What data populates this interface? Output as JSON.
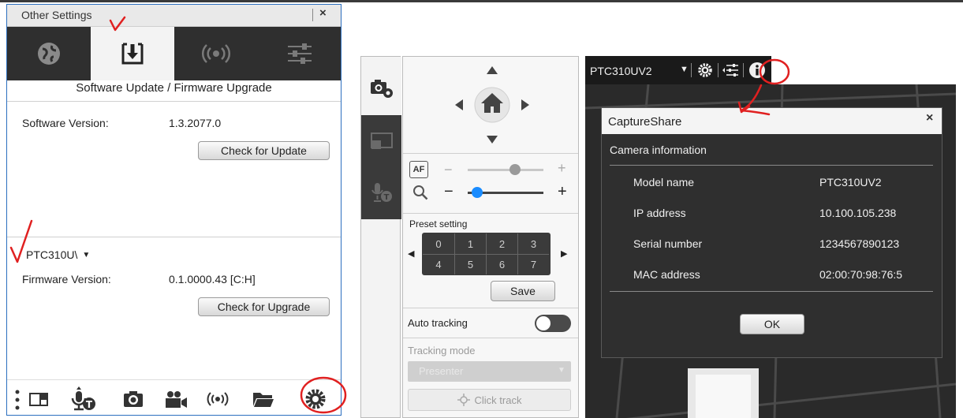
{
  "other_settings": {
    "title": "Other Settings",
    "close_label": "×",
    "tabs": [
      {
        "icon": "globe-icon"
      },
      {
        "icon": "download-icon",
        "active": true
      },
      {
        "icon": "broadcast-icon"
      },
      {
        "icon": "sliders-icon"
      }
    ],
    "section_title": "Software Update / Firmware Upgrade",
    "software_version_label": "Software Version:",
    "software_version_value": "1.3.2077.0",
    "check_update_label": "Check for Update",
    "device_select_value": "PTC310U\\",
    "firmware_version_label": "Firmware Version:",
    "firmware_version_value": "0.1.0000.43 [C:H]",
    "check_upgrade_label": "Check for Upgrade",
    "bottom_icons": [
      "layout-icon",
      "mic-text-icon",
      "camera-icon",
      "video-camera-icon",
      "broadcast-icon",
      "folder-icon",
      "gear-icon"
    ]
  },
  "control_panel": {
    "side_tabs": [
      "camera-settings-icon",
      "screen-share-icon",
      "mic-text-icon"
    ],
    "af_label": "AF",
    "preset_label": "Preset setting",
    "presets": [
      "0",
      "1",
      "2",
      "3",
      "4",
      "5",
      "6",
      "7"
    ],
    "save_label": "Save",
    "auto_tracking_label": "Auto tracking",
    "tracking_mode_label": "Tracking mode",
    "tracking_mode_value": "Presenter",
    "click_track_label": "Click track",
    "auto_tracking": {
      "on": false
    },
    "zoom_level": 0.12,
    "focus_level": 0.62
  },
  "camera_view": {
    "camera_name": "PTC310UV2",
    "dialog": {
      "title": "CaptureShare",
      "close_label": "×",
      "section": "Camera information",
      "rows": [
        {
          "key": "Model name",
          "value": "PTC310UV2"
        },
        {
          "key": "IP address",
          "value": "10.100.105.238"
        },
        {
          "key": "Serial number",
          "value": "1234567890123"
        },
        {
          "key": "MAC address",
          "value": "02:00:70:98:76:5"
        }
      ],
      "ok_label": "OK"
    }
  },
  "colors": {
    "accent_blue": "#1a8cff",
    "annotation_red": "#e02020",
    "dark_panel": "#2f2f2f"
  }
}
